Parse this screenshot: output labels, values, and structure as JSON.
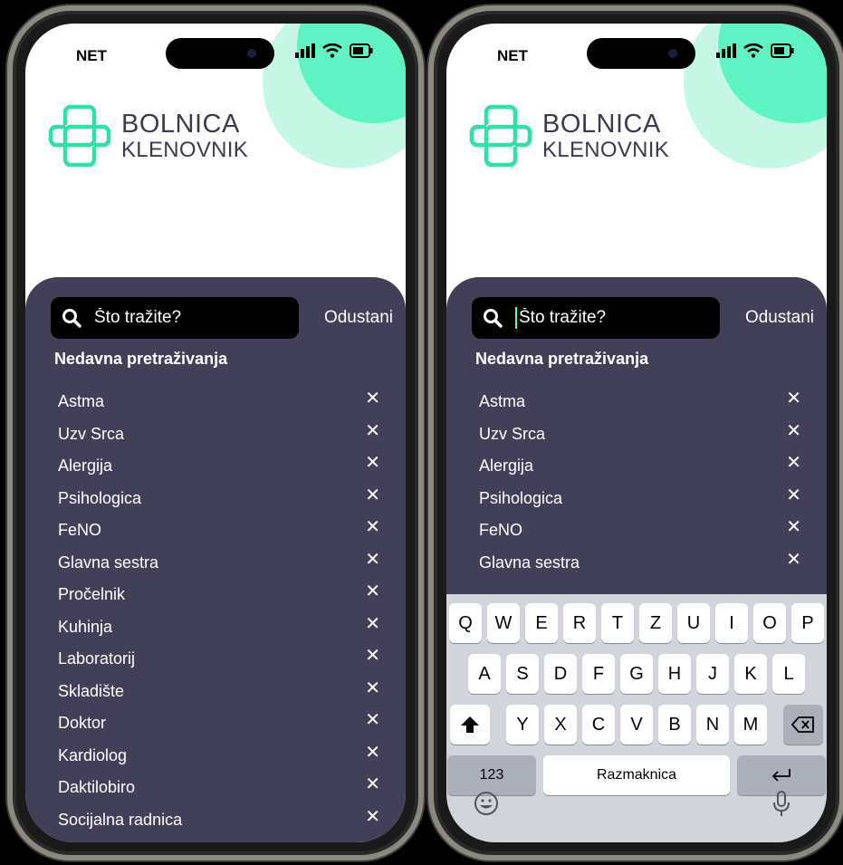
{
  "status_bar": {
    "carrier": "NET"
  },
  "logo": {
    "title": "BOLNICA",
    "subtitle": "KLENOVNIK"
  },
  "search": {
    "placeholder": "Što tražite?",
    "cancel_label": "Odustani"
  },
  "recent": {
    "title": "Nedavna pretraživanja",
    "items_left": [
      "Astma",
      "Uzv Srca",
      "Alergija",
      "Psihologica",
      "FeNO",
      "Glavna sestra",
      "Pročelnik",
      "Kuhinja",
      "Laboratorij",
      "Skladište",
      "Doktor",
      "Kardiolog",
      "Daktilobiro",
      "Socijalna radnica"
    ],
    "items_right": [
      "Astma",
      "Uzv Srca",
      "Alergija",
      "Psihologica",
      "FeNO",
      "Glavna sestra"
    ],
    "remove_glyph": "✕"
  },
  "keyboard": {
    "row1": [
      "Q",
      "W",
      "E",
      "R",
      "T",
      "Z",
      "U",
      "I",
      "O",
      "P"
    ],
    "row2": [
      "A",
      "S",
      "D",
      "F",
      "G",
      "H",
      "J",
      "K",
      "L"
    ],
    "row3": [
      "Y",
      "X",
      "C",
      "V",
      "B",
      "N",
      "M"
    ],
    "numbers_label": "123",
    "space_label": "Razmaknica"
  },
  "colors": {
    "accent": "#5ff2c3",
    "sheet": "#423f59",
    "logo_text": "#3d3a4f"
  },
  "icons": [
    "search-icon",
    "signal-icon",
    "wifi-icon",
    "battery-icon",
    "close-icon",
    "shift-icon",
    "backspace-icon",
    "return-icon",
    "emoji-icon",
    "mic-icon",
    "hospital-cross-icon"
  ]
}
